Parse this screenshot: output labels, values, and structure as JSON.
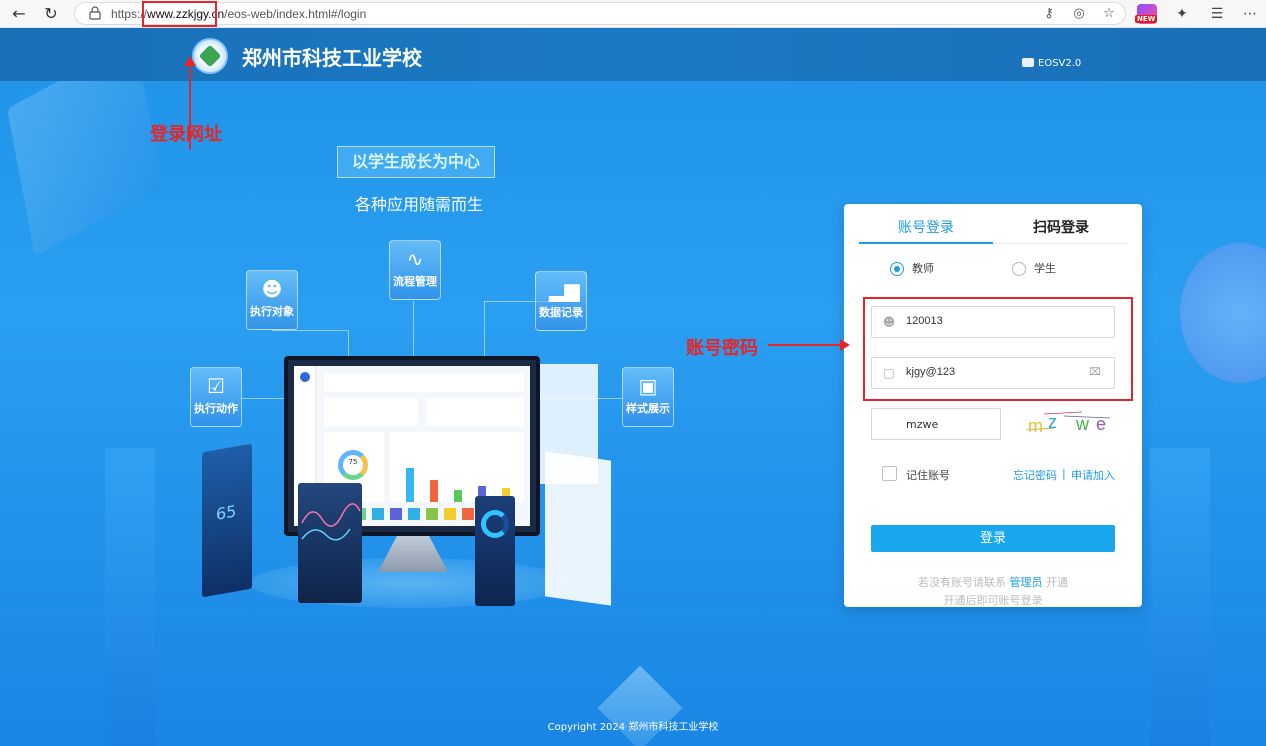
{
  "browser": {
    "url_scheme": "https://",
    "url_domain": "www.zzkjgy.cn",
    "url_path": "/eos-web/index.html#/login",
    "badge_new": "NEW"
  },
  "header": {
    "school_name": "郑州市科技工业学校",
    "version": "EOSV2.0"
  },
  "hero": {
    "slogan": "以学生成长为中心",
    "sub_slogan": "各种应用随需而生",
    "features": [
      {
        "label": "执行对象",
        "icon": "user-icon"
      },
      {
        "label": "流程管理",
        "icon": "flow-icon"
      },
      {
        "label": "数据记录",
        "icon": "chart-icon"
      },
      {
        "label": "执行动作",
        "icon": "checklist-icon"
      },
      {
        "label": "样式展示",
        "icon": "presentation-icon"
      }
    ],
    "panel_number": "65",
    "donut_value": "75"
  },
  "annotations": {
    "url_label": "登录网址",
    "account_label": "账号密码"
  },
  "login": {
    "tabs": [
      {
        "label": "账号登录"
      },
      {
        "label": "扫码登录"
      }
    ],
    "roles": [
      {
        "label": "教师",
        "selected": true
      },
      {
        "label": "学生",
        "selected": false
      }
    ],
    "username": "120013",
    "password": "kjgy@123",
    "captcha_input": "mzwe",
    "captcha_chars": [
      "m",
      "z",
      "w",
      "e"
    ],
    "remember_label": "记住账号",
    "forgot_label": "忘记密码",
    "separator": "|",
    "apply_label": "申请加入",
    "submit_label": "登录",
    "hint_line1_prefix": "若没有账号请联系",
    "hint_admin": "管理员",
    "hint_line1_suffix": "开通",
    "hint_line2": "开通后即可账号登录"
  },
  "footer": {
    "copyright": "Copyright 2024 郑州市科技工业学校"
  },
  "colors": {
    "accent": "#1d9de5",
    "annotation_red": "#e4262a",
    "page_blue": "#2a9ef0"
  }
}
